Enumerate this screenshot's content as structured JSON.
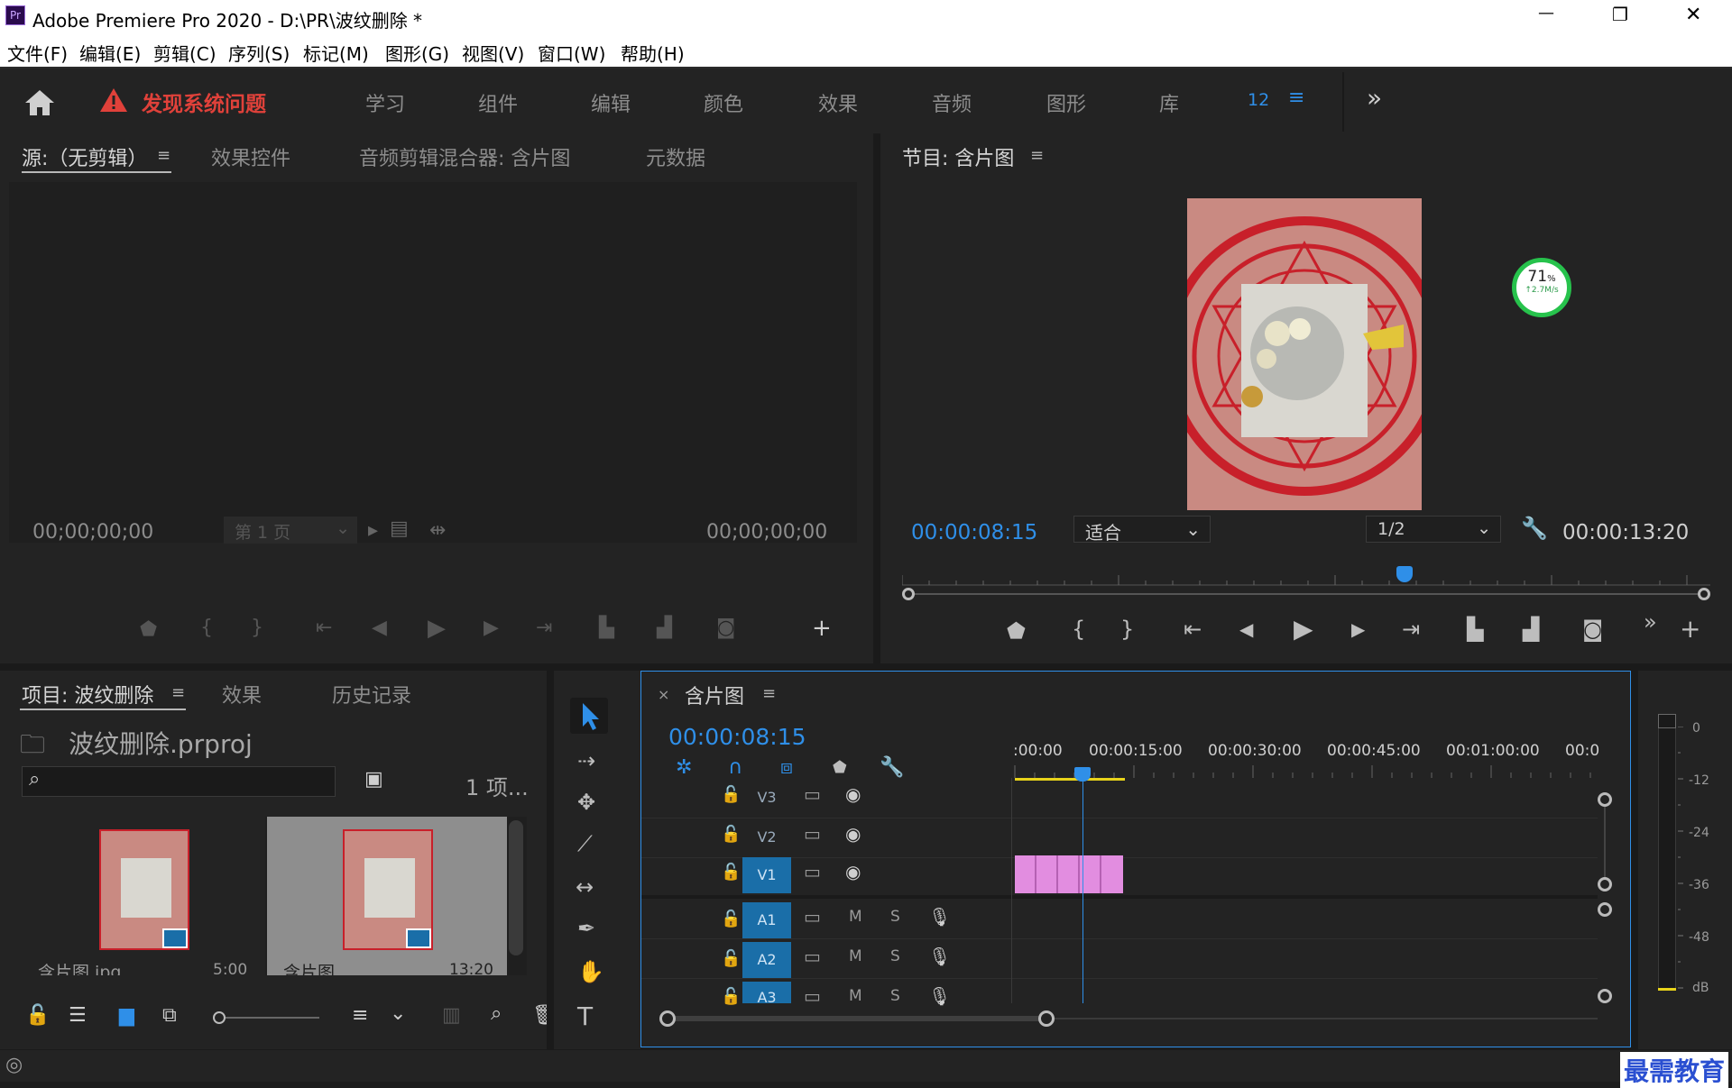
{
  "window": {
    "app_icon": "Pr",
    "title": "Adobe Premiere Pro 2020 - D:\\PR\\波纹删除 *",
    "minimize": "—",
    "restore": "❐",
    "close": "✕"
  },
  "menu": [
    "文件(F)",
    "编辑(E)",
    "剪辑(C)",
    "序列(S)",
    "标记(M)",
    "图形(G)",
    "视图(V)",
    "窗口(W)",
    "帮助(H)"
  ],
  "workspace": {
    "alert": "发现系统问题",
    "tabs": [
      "学习",
      "组件",
      "编辑",
      "颜色",
      "效果",
      "音频",
      "图形",
      "库"
    ],
    "count": "12",
    "more": "»"
  },
  "source_panel": {
    "tabs": [
      "源:（无剪辑）",
      "效果控件",
      "音频剪辑混合器: 含片图",
      "元数据"
    ],
    "timecode_left": "00;00;00;00",
    "page_select": "第 1 页",
    "timecode_right": "00;00;00;00"
  },
  "program_panel": {
    "title": "节目: 含片图",
    "timecode": "00:00:08:15",
    "fit_select": "适合",
    "quality_select": "1/2",
    "duration": "00:00:13:20",
    "net_percent": "71",
    "net_unit": "%",
    "net_speed": "↑2.7M/s",
    "playhead_fraction": 0.622
  },
  "project_panel": {
    "tabs": [
      "项目: 波纹删除",
      "效果",
      "历史记录"
    ],
    "project_file": "波纹删除.prproj",
    "item_count": "1 项...",
    "items": [
      {
        "name": "含片图.jpg",
        "duration": "5:00"
      },
      {
        "name": "含片图",
        "duration": "13:20"
      }
    ]
  },
  "timeline": {
    "sequence_name": "含片图",
    "timecode": "00:00:08:15",
    "ruler": [
      ":00:00",
      "00:00:15:00",
      "00:00:30:00",
      "00:00:45:00",
      "00:01:00:00",
      "00:0"
    ],
    "video_tracks": [
      "V3",
      "V2",
      "V1"
    ],
    "audio_tracks": [
      "A1",
      "A2",
      "A3"
    ],
    "mute": "M",
    "solo": "S",
    "clip_color": "#e28de0",
    "clip_segments": 5
  },
  "audio_meter": {
    "scale": [
      "0",
      "-12",
      "-24",
      "-36",
      "-48",
      "dB"
    ]
  },
  "watermark": "最需教育",
  "colors": {
    "accent_blue": "#2f8fe8",
    "alert_red": "#e0413a",
    "clip_pink": "#e28de0",
    "track_active": "#1a6ea8"
  }
}
